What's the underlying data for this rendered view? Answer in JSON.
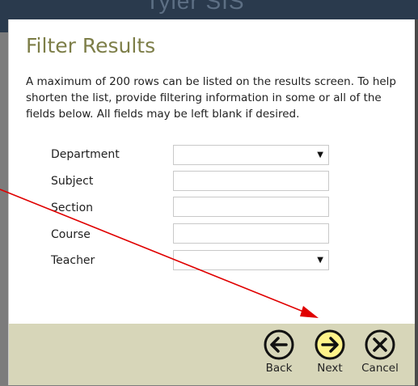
{
  "header": {
    "brand": "Tyler SIS"
  },
  "dialog": {
    "title": "Filter Results",
    "description": "A maximum of 200 rows can be listed on the results screen. To help shorten the list, provide filtering information in some or all of the fields below. All fields may be left blank if desired."
  },
  "fields": [
    {
      "label": "Department",
      "type": "select",
      "value": ""
    },
    {
      "label": "Subject",
      "type": "text",
      "value": ""
    },
    {
      "label": "Section",
      "type": "text",
      "value": ""
    },
    {
      "label": "Course",
      "type": "text",
      "value": ""
    },
    {
      "label": "Teacher",
      "type": "select",
      "value": ""
    }
  ],
  "footer": {
    "back_label": "Back",
    "next_label": "Next",
    "cancel_label": "Cancel"
  },
  "colors": {
    "title": "#7d7e48",
    "footer_bg": "#d7d6b9",
    "next_highlight": "#fff38a",
    "annotation_arrow": "#e00000"
  }
}
